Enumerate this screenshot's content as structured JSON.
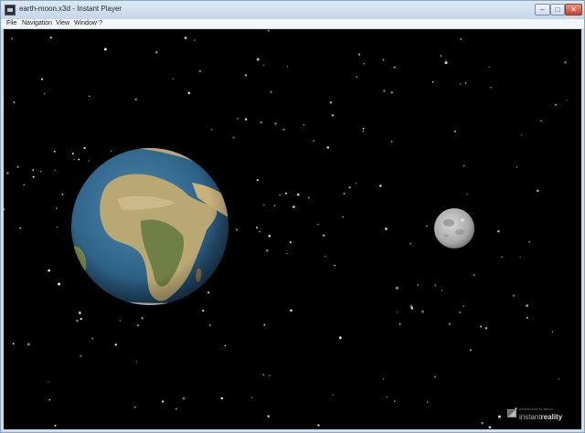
{
  "window": {
    "title": "earth-moon.x3d - Instant Player",
    "buttons": {
      "minimize": "–",
      "maximize": "□",
      "close": "✕"
    }
  },
  "menu": {
    "items": [
      "File",
      "Navigation",
      "View",
      "Window",
      "?"
    ]
  },
  "scene": {
    "background_color": "#000000",
    "earth_icon": "earth-globe",
    "moon_icon": "moon-sphere",
    "logo": {
      "tagline": "PROFESSIONAL MEDIA",
      "brand_light": "instant",
      "brand_bold": "reality"
    }
  }
}
